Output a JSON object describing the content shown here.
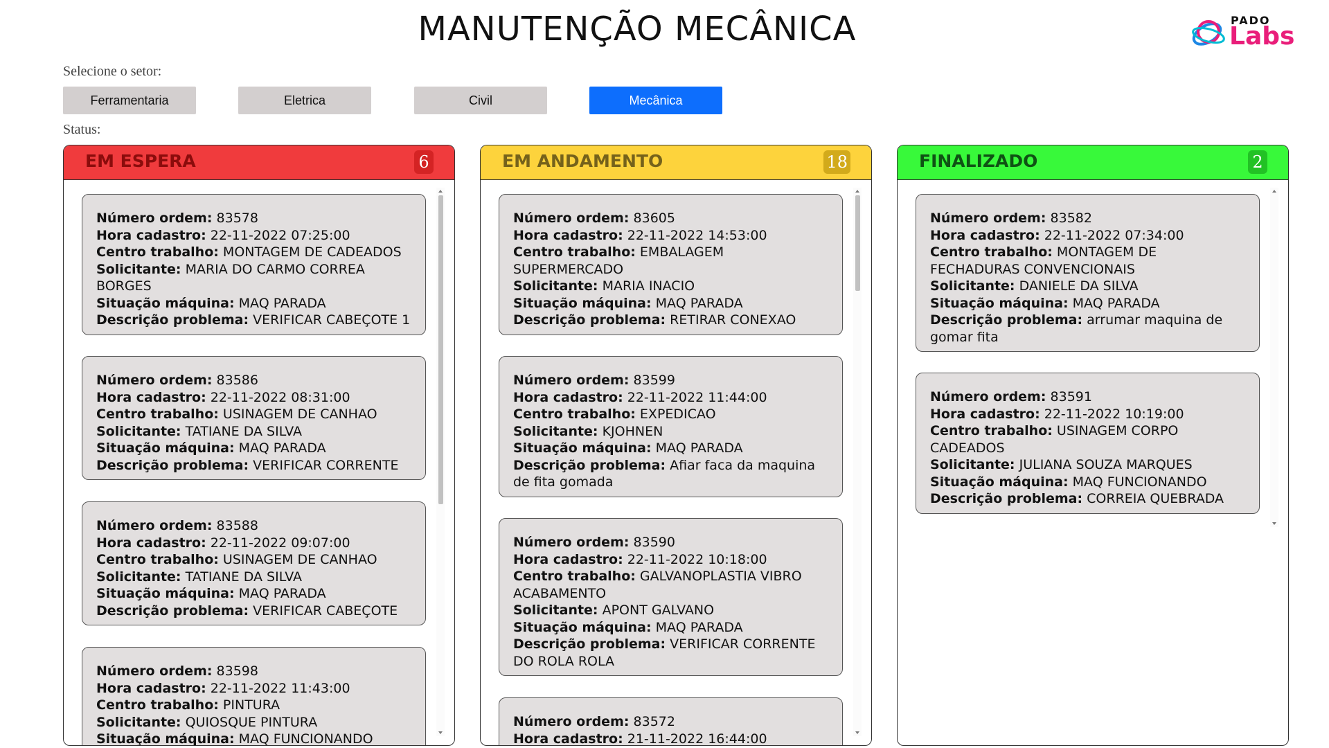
{
  "page": {
    "title": "MANUTENÇÃO MECÂNICA"
  },
  "logo": {
    "small_text": "PADO",
    "big_text": "Labs"
  },
  "sector_label": "Selecione o setor:",
  "status_label": "Status:",
  "sectors": [
    {
      "label": "Ferramentaria",
      "active": false
    },
    {
      "label": "Eletrica",
      "active": false
    },
    {
      "label": "Civil",
      "active": false
    },
    {
      "label": "Mecânica",
      "active": true
    }
  ],
  "field_labels": {
    "numero": "Número ordem:",
    "hora": "Hora cadastro:",
    "centro": "Centro trabalho:",
    "solicitante": "Solicitante:",
    "situacao": "Situação máquina:",
    "descricao": "Descrição problema:"
  },
  "columns": [
    {
      "title": "EM ESPERA",
      "count": "6",
      "cards": [
        {
          "numero": "83578",
          "hora": "22-11-2022 07:25:00",
          "centro": "MONTAGEM DE CADEADOS",
          "solicitante": "MARIA DO CARMO CORREA BORGES",
          "situacao": "MAQ PARADA",
          "descricao": "VERIFICAR CABEÇOTE 1"
        },
        {
          "numero": "83586",
          "hora": "22-11-2022 08:31:00",
          "centro": "USINAGEM DE CANHAO",
          "solicitante": "TATIANE DA SILVA",
          "situacao": "MAQ PARADA",
          "descricao": "VERIFICAR CORRENTE"
        },
        {
          "numero": "83588",
          "hora": "22-11-2022 09:07:00",
          "centro": "USINAGEM DE CANHAO",
          "solicitante": "TATIANE DA SILVA",
          "situacao": "MAQ PARADA",
          "descricao": "VERIFICAR CABEÇOTE"
        },
        {
          "numero": "83598",
          "hora": "22-11-2022 11:43:00",
          "centro": "PINTURA",
          "solicitante": "QUIOSQUE PINTURA",
          "situacao": "MAQ FUNCIONANDO",
          "descricao": ""
        }
      ]
    },
    {
      "title": "EM ANDAMENTO",
      "count": "18",
      "cards": [
        {
          "numero": "83605",
          "hora": "22-11-2022 14:53:00",
          "centro": "EMBALAGEM SUPERMERCADO",
          "solicitante": "MARIA INACIO",
          "situacao": "MAQ PARADA",
          "descricao": "RETIRAR CONEXAO"
        },
        {
          "numero": "83599",
          "hora": "22-11-2022 11:44:00",
          "centro": "EXPEDICAO",
          "solicitante": "KJOHNEN",
          "situacao": "MAQ PARADA",
          "descricao": "Afiar faca da maquina de fita gomada"
        },
        {
          "numero": "83590",
          "hora": "22-11-2022 10:18:00",
          "centro": "GALVANOPLASTIA VIBRO ACABAMENTO",
          "solicitante": "APONT GALVANO",
          "situacao": "MAQ PARADA",
          "descricao": "VERIFICAR CORRENTE DO ROLA ROLA"
        },
        {
          "numero": "83572",
          "hora": "21-11-2022 16:44:00",
          "centro": "",
          "solicitante": "",
          "situacao": "",
          "descricao": ""
        }
      ]
    },
    {
      "title": "FINALIZADO",
      "count": "2",
      "cards": [
        {
          "numero": "83582",
          "hora": "22-11-2022 07:34:00",
          "centro": "MONTAGEM DE FECHADURAS CONVENCIONAIS",
          "solicitante": "DANIELE DA SILVA",
          "situacao": "MAQ PARADA",
          "descricao": "arrumar maquina de gomar fita"
        },
        {
          "numero": "83591",
          "hora": "22-11-2022 10:19:00",
          "centro": "USINAGEM CORPO CADEADOS",
          "solicitante": "JULIANA SOUZA MARQUES",
          "situacao": "MAQ FUNCIONANDO",
          "descricao": "CORREIA QUEBRADA"
        }
      ]
    }
  ]
}
